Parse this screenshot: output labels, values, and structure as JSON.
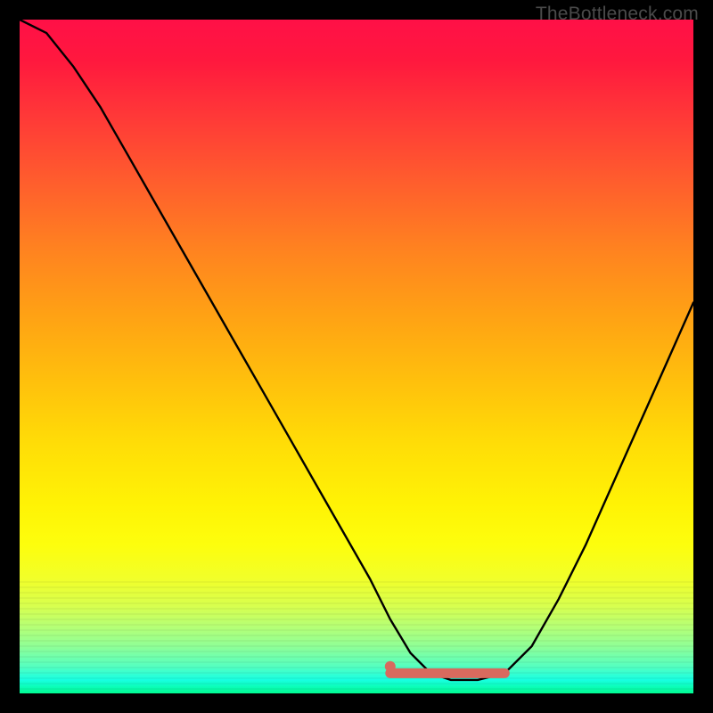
{
  "watermark": "TheBottleneck.com",
  "colors": {
    "background": "#000000",
    "curve": "#000000",
    "marker": "#d86a5e",
    "gradient_top": "#ff1348",
    "gradient_bottom": "#00fc91"
  },
  "chart_data": {
    "type": "line",
    "title": "",
    "xlabel": "",
    "ylabel": "",
    "xlim": [
      0,
      100
    ],
    "ylim": [
      0,
      100
    ],
    "grid": false,
    "legend": false,
    "series": [
      {
        "name": "bottleneck-curve",
        "x": [
          0,
          4,
          8,
          12,
          16,
          20,
          24,
          28,
          32,
          36,
          40,
          44,
          48,
          52,
          55,
          58,
          61,
          64,
          68,
          72,
          76,
          80,
          84,
          88,
          92,
          96,
          100
        ],
        "values": [
          100,
          98,
          93,
          87,
          80,
          73,
          66,
          59,
          52,
          45,
          38,
          31,
          24,
          17,
          11,
          6,
          3,
          2,
          2,
          3,
          7,
          14,
          22,
          31,
          40,
          49,
          58
        ],
        "note": "values are relative bottleneck percentage on the y-axis; curve reaches a flat minimum near x=61-72 at y≈2, left arm rises steeply to 100, right arm rises to ~58"
      }
    ],
    "markers": [
      {
        "name": "optimal-range-left-endpoint",
        "x": 55,
        "y": 4,
        "shape": "dot",
        "color": "#d86a5e"
      },
      {
        "name": "optimal-range-band",
        "x_start": 55,
        "x_end": 72,
        "y": 3,
        "shape": "thick-line",
        "color": "#d86a5e"
      }
    ]
  }
}
